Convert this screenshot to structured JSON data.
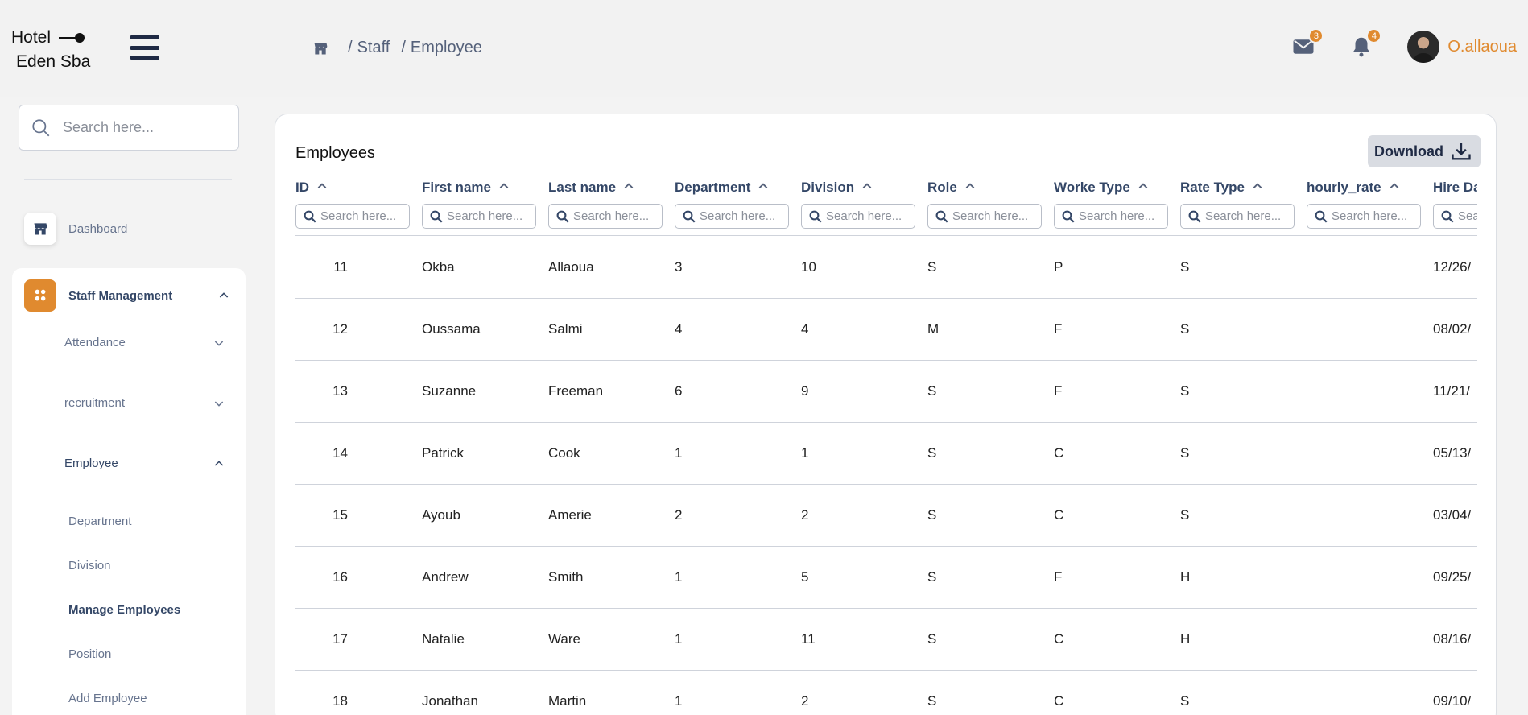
{
  "app": {
    "logo_line1": "Hotel",
    "logo_line2": "Eden Sba",
    "accent_color": "#e08a2f"
  },
  "breadcrumb": {
    "home_icon": "store-icon",
    "items": [
      "Staff",
      "Employee"
    ],
    "separator": "/"
  },
  "header": {
    "mail_count": "3",
    "notification_count": "4",
    "username": "O.allaoua"
  },
  "sidebar": {
    "search_placeholder": "Search here...",
    "dashboard_label": "Dashboard",
    "section_label": "Staff Management",
    "sub_items": [
      {
        "label": "Attendance",
        "expanded": false
      },
      {
        "label": "recruitment",
        "expanded": false
      },
      {
        "label": "Employee",
        "expanded": true
      }
    ],
    "employee_children": [
      "Department",
      "Division",
      "Manage Employees",
      "Position",
      "Add Employee"
    ],
    "active_child": "Manage Employees"
  },
  "main": {
    "card_title": "Employees",
    "download_label": "Download",
    "filter_placeholder": "Search here...",
    "columns": [
      "ID",
      "First name",
      "Last name",
      "Department",
      "Division",
      "Role",
      "Worke Type",
      "Rate Type",
      "hourly_rate",
      "Hire Date"
    ],
    "rows": [
      [
        "11",
        "Okba",
        "Allaoua",
        "3",
        "10",
        "S",
        "P",
        "S",
        "",
        "12/26/"
      ],
      [
        "12",
        "Oussama",
        "Salmi",
        "4",
        "4",
        "M",
        "F",
        "S",
        "",
        "08/02/"
      ],
      [
        "13",
        "Suzanne",
        "Freeman",
        "6",
        "9",
        "S",
        "F",
        "S",
        "",
        "11/21/"
      ],
      [
        "14",
        "Patrick",
        "Cook",
        "1",
        "1",
        "S",
        "C",
        "S",
        "",
        "05/13/"
      ],
      [
        "15",
        "Ayoub",
        "Amerie",
        "2",
        "2",
        "S",
        "C",
        "S",
        "",
        "03/04/"
      ],
      [
        "16",
        "Andrew",
        "Smith",
        "1",
        "5",
        "S",
        "F",
        "H",
        "",
        "09/25/"
      ],
      [
        "17",
        "Natalie",
        "Ware",
        "1",
        "11",
        "S",
        "C",
        "H",
        "",
        "08/16/"
      ],
      [
        "18",
        "Jonathan",
        "Martin",
        "1",
        "2",
        "S",
        "C",
        "S",
        "",
        "09/10/"
      ]
    ]
  }
}
